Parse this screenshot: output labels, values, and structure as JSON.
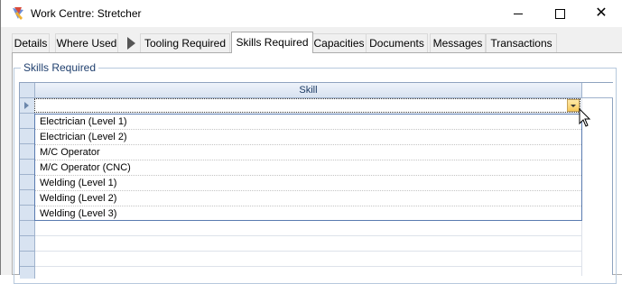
{
  "window": {
    "title": "Work Centre: Stretcher",
    "controls": {
      "minimize": "minimize",
      "maximize": "maximize",
      "close": "✕"
    }
  },
  "tabs": [
    {
      "label": "Details",
      "active": false
    },
    {
      "label": "Where Used",
      "active": false
    },
    {
      "label": "Tooling Required",
      "active": false
    },
    {
      "label": "Skills Required",
      "active": true
    },
    {
      "label": "Capacities",
      "active": false
    },
    {
      "label": "Documents",
      "active": false
    },
    {
      "label": "Messages",
      "active": false
    },
    {
      "label": "Transactions",
      "active": false
    }
  ],
  "group": {
    "label": "Skills Required"
  },
  "grid": {
    "columns": [
      "Skill"
    ],
    "current_value": ""
  },
  "dropdown": {
    "items": [
      "Electrician (Level 1)",
      "Electrician (Level 2)",
      "M/C Operator",
      "M/C Operator (CNC)",
      "Welding (Level 1)",
      "Welding (Level 2)",
      "Welding (Level 3)"
    ]
  },
  "colors": {
    "header_bg": "#d8e3f1",
    "group_label": "#1f3f6e",
    "dropdown_button": "#f7c95a"
  }
}
